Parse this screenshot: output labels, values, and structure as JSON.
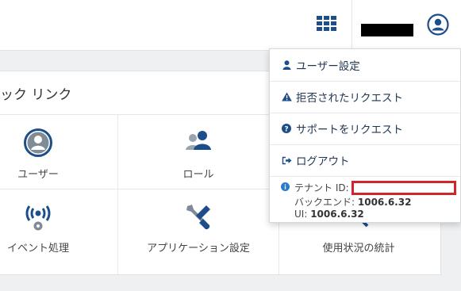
{
  "panel": {
    "title": "ック リンク",
    "tiles": [
      {
        "label": "ユーザー",
        "icon": "user-circle-icon"
      },
      {
        "label": "ロール",
        "icon": "users-icon"
      },
      {
        "label": "イベント処理",
        "icon": "broadcast-gear-icon"
      },
      {
        "label": "アプリケーション設定",
        "icon": "wrench-screwdriver-icon"
      },
      {
        "label": "使用状況の統計",
        "icon": "magnifier-chart-icon"
      }
    ]
  },
  "dropdown": {
    "items": [
      {
        "label": "ユーザー設定",
        "icon": "user-icon"
      },
      {
        "label": "拒否されたリクエスト",
        "icon": "warning-icon"
      },
      {
        "label": "サポートをリクエスト",
        "icon": "question-circle-icon"
      },
      {
        "label": "ログアウト",
        "icon": "sign-out-icon"
      }
    ],
    "info": {
      "tenant_label": "テナント ID:",
      "backend_label": "バックエンド:",
      "backend_version": "1006.6.32",
      "ui_label": "UI:",
      "ui_version": "1006.6.32"
    }
  },
  "colors": {
    "primary": "#1d4e89",
    "icon_gray": "#7f8b97",
    "redaction_border": "#d2242b"
  }
}
